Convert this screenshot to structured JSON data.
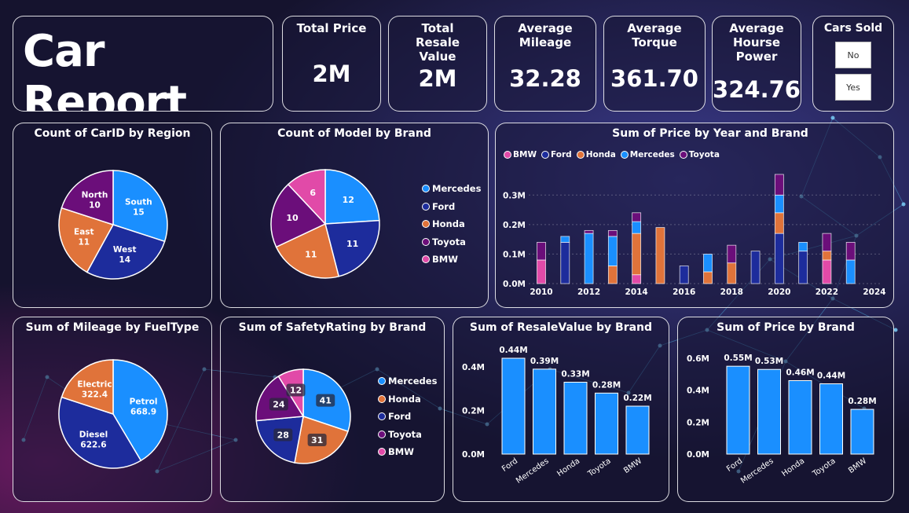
{
  "colors": {
    "mercedes": "#1a8fff",
    "ford": "#1d2c9c",
    "honda": "#e0733a",
    "toyota": "#6b0e7a",
    "bmw": "#e14aa8",
    "bar": "#1a8fff"
  },
  "header": {
    "title": "Car Report"
  },
  "kpis": [
    {
      "label": "Total Price",
      "value": "2M"
    },
    {
      "label": "Total Resale Value",
      "value": "2M"
    },
    {
      "label": "Average Mileage",
      "value": "32.28"
    },
    {
      "label": "Average Torque",
      "value": "361.70"
    },
    {
      "label": "Average Hourse Power",
      "value": "324.76"
    }
  ],
  "slicer": {
    "title": "Cars Sold",
    "options": [
      "No",
      "Yes"
    ]
  },
  "charts": {
    "region": {
      "title": "Count of CarID by Region",
      "chart_data": {
        "type": "pie",
        "slices": [
          {
            "label": "South",
            "value": 15,
            "color": "#1a8fff"
          },
          {
            "label": "West",
            "value": 14,
            "color": "#1d2c9c"
          },
          {
            "label": "East",
            "value": 11,
            "color": "#e0733a"
          },
          {
            "label": "North",
            "value": 10,
            "color": "#6b0e7a"
          }
        ]
      }
    },
    "model": {
      "title": "Count of Model by Brand",
      "legend": [
        "Mercedes",
        "Ford",
        "Honda",
        "Toyota",
        "BMW"
      ],
      "chart_data": {
        "type": "pie",
        "slices": [
          {
            "label": "Mercedes",
            "value": 12,
            "color": "#1a8fff"
          },
          {
            "label": "Ford",
            "value": 11,
            "color": "#1d2c9c"
          },
          {
            "label": "Honda",
            "value": 11,
            "color": "#e0733a"
          },
          {
            "label": "Toyota",
            "value": 10,
            "color": "#6b0e7a"
          },
          {
            "label": "BMW",
            "value": 6,
            "color": "#e14aa8"
          }
        ]
      }
    },
    "year": {
      "title": "Sum of Price by Year and Brand",
      "legend": [
        "BMW",
        "Ford",
        "Honda",
        "Mercedes",
        "Toyota"
      ],
      "chart_data": {
        "type": "bar",
        "stacked": true,
        "x": [
          2010,
          2011,
          2012,
          2013,
          2014,
          2015,
          2016,
          2017,
          2018,
          2019,
          2020,
          2021,
          2022,
          2023
        ],
        "x_ticks": [
          "2010",
          "2012",
          "2014",
          "2016",
          "2018",
          "2020",
          "2022",
          "2024"
        ],
        "y_ticks": [
          "0.0M",
          "0.1M",
          "0.2M",
          "0.3M"
        ],
        "ylim": [
          0,
          0.33
        ],
        "series": [
          {
            "name": "BMW",
            "color": "#e14aa8",
            "values": [
              0.08,
              0,
              0,
              0,
              0.03,
              0,
              0,
              0,
              0,
              0,
              0,
              0,
              0.08,
              0
            ]
          },
          {
            "name": "Ford",
            "color": "#1d2c9c",
            "values": [
              0,
              0.14,
              0,
              0,
              0,
              0,
              0.06,
              0,
              0,
              0.11,
              0.17,
              0.11,
              0,
              0
            ]
          },
          {
            "name": "Honda",
            "color": "#e0733a",
            "values": [
              0,
              0,
              0,
              0.06,
              0.14,
              0.19,
              0,
              0.04,
              0.07,
              0,
              0.07,
              0,
              0.03,
              0
            ]
          },
          {
            "name": "Mercedes",
            "color": "#1a8fff",
            "values": [
              0,
              0.02,
              0.17,
              0.1,
              0.04,
              0,
              0,
              0.06,
              0,
              0,
              0.06,
              0.03,
              0,
              0.08
            ]
          },
          {
            "name": "Toyota",
            "color": "#6b0e7a",
            "values": [
              0.06,
              0,
              0.01,
              0.02,
              0.03,
              0,
              0,
              0,
              0.06,
              0,
              0.07,
              0,
              0.06,
              0.06
            ]
          }
        ]
      }
    },
    "fuel": {
      "title": "Sum of Mileage by FuelType",
      "chart_data": {
        "type": "pie",
        "slices": [
          {
            "label": "Petrol",
            "value": 668.9,
            "color": "#1a8fff"
          },
          {
            "label": "Diesel",
            "value": 622.6,
            "color": "#1d2c9c"
          },
          {
            "label": "Electric",
            "value": 322.4,
            "color": "#e0733a"
          }
        ]
      }
    },
    "safety": {
      "title": "Sum of SafetyRating by Brand",
      "legend": [
        "Mercedes",
        "Honda",
        "Ford",
        "Toyota",
        "BMW"
      ],
      "chart_data": {
        "type": "pie",
        "slices": [
          {
            "label": "Mercedes",
            "value": 41,
            "color": "#1a8fff"
          },
          {
            "label": "Honda",
            "value": 31,
            "color": "#e0733a"
          },
          {
            "label": "Ford",
            "value": 28,
            "color": "#1d2c9c"
          },
          {
            "label": "Toyota",
            "value": 24,
            "color": "#6b0e7a"
          },
          {
            "label": "BMW",
            "value": 12,
            "color": "#e14aa8"
          }
        ]
      }
    },
    "resale": {
      "title": "Sum of ResaleValue by Brand",
      "chart_data": {
        "type": "bar",
        "categories": [
          "Ford",
          "Mercedes",
          "Honda",
          "Toyota",
          "BMW"
        ],
        "values": [
          0.44,
          0.39,
          0.33,
          0.28,
          0.22
        ],
        "labels": [
          "0.44M",
          "0.39M",
          "0.33M",
          "0.28M",
          "0.22M"
        ],
        "y_ticks": [
          "0.0M",
          "0.2M",
          "0.4M"
        ],
        "ylim": [
          0,
          0.44
        ]
      }
    },
    "price": {
      "title": "Sum of Price by Brand",
      "chart_data": {
        "type": "bar",
        "categories": [
          "Ford",
          "Mercedes",
          "Honda",
          "Toyota",
          "BMW"
        ],
        "values": [
          0.55,
          0.53,
          0.46,
          0.44,
          0.28
        ],
        "labels": [
          "0.55M",
          "0.53M",
          "0.46M",
          "0.44M",
          "0.28M"
        ],
        "y_ticks": [
          "0.0M",
          "0.2M",
          "0.4M",
          "0.6M"
        ],
        "ylim": [
          0,
          0.6
        ]
      }
    }
  }
}
